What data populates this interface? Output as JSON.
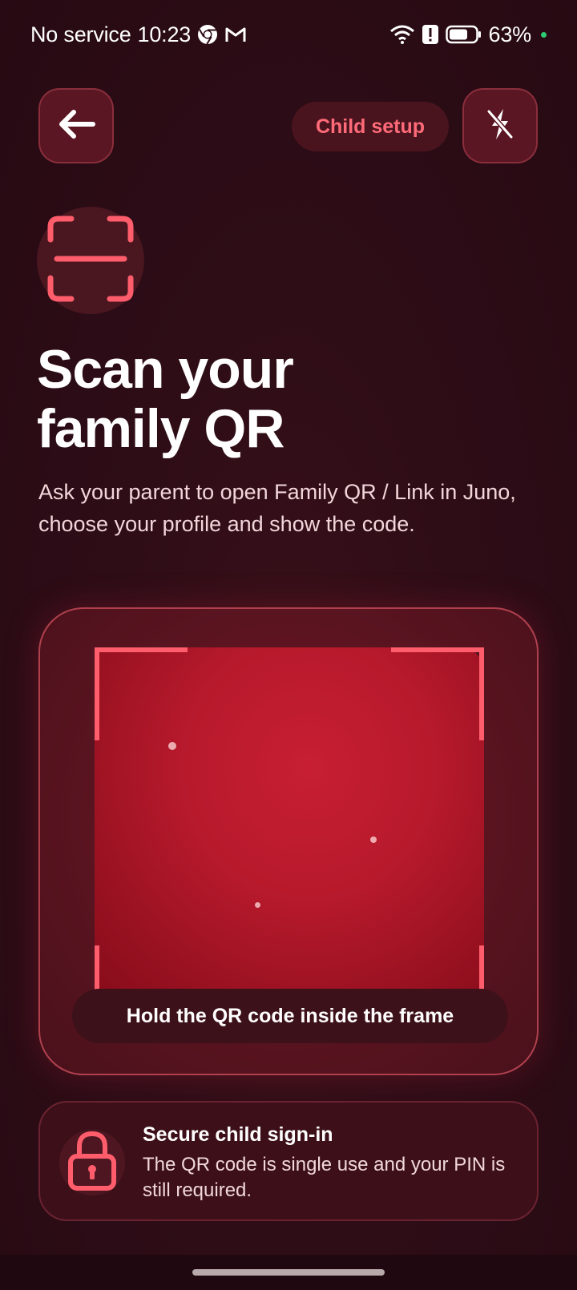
{
  "status_bar": {
    "carrier": "No service",
    "time": "10:23",
    "battery": "63%"
  },
  "header": {
    "chip_label": "Child setup",
    "icons": [
      "back-arrow-icon",
      "flash-off-icon"
    ]
  },
  "main": {
    "title_line1": "Scan your",
    "title_line2": "family QR",
    "subtitle": "Ask your parent to open Family QR / Link in Juno, choose your profile and show the code."
  },
  "scanner": {
    "hint": "Hold the QR code inside the frame"
  },
  "secure": {
    "title": "Secure child sign-in",
    "text": "The QR code is single use and your PIN is still required."
  },
  "colors": {
    "accent": "#ff5d6b",
    "background": "#2d0c16",
    "card": "#5a1420"
  }
}
